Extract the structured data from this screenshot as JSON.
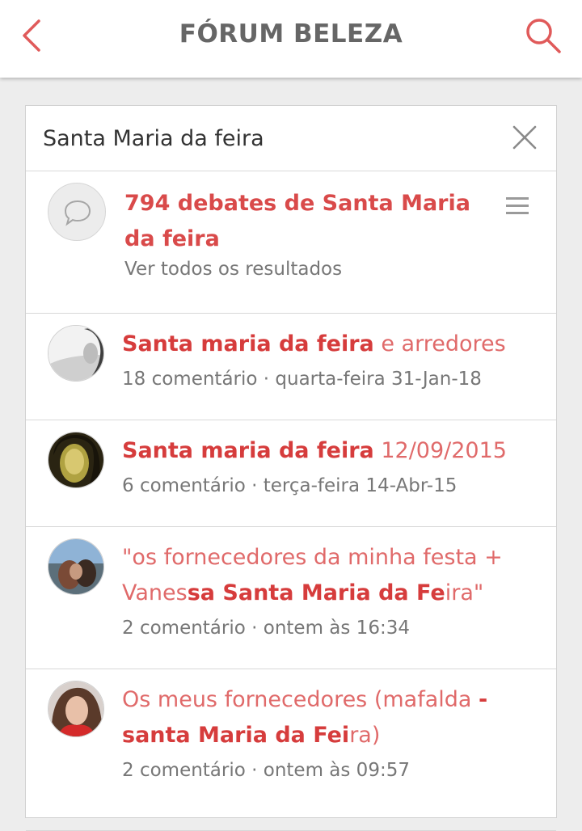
{
  "header": {
    "title": "FÓRUM BELEZA",
    "back_icon": "chevron-left-icon",
    "search_icon": "search-icon",
    "accent_color": "#e05a5a"
  },
  "search": {
    "value": "Santa Maria da feira",
    "clear_icon": "close-icon"
  },
  "summary": {
    "title": "794 debates de Santa Maria da feira",
    "subtitle": "Ver todos os resultados",
    "icon": "chat-bubble-icon",
    "menu_icon": "menu-icon"
  },
  "results": [
    {
      "title_bold": "Santa maria da feira",
      "title_rest": " e arredores",
      "comments": "18 comentário",
      "date": "quarta-feira 31-Jan-18"
    },
    {
      "title_bold": "Santa maria da feira",
      "title_rest": " 12/09/2015",
      "comments": "6 comentário",
      "date": "terça-feira 14-Abr-15"
    },
    {
      "title_pre": "\"os fornecedores da minha festa + Vanes",
      "title_bold": "sa Santa Maria da Fe",
      "title_post": "ira\"",
      "comments": "2 comentário",
      "date": "ontem às 16:34"
    },
    {
      "title_pre": "Os meus fornecedores (mafalda ",
      "title_bold": "- santa Maria da Fei",
      "title_post": "ra)",
      "comments": "2 comentário",
      "date": "ontem às 09:57"
    }
  ],
  "meta_separator": " · "
}
